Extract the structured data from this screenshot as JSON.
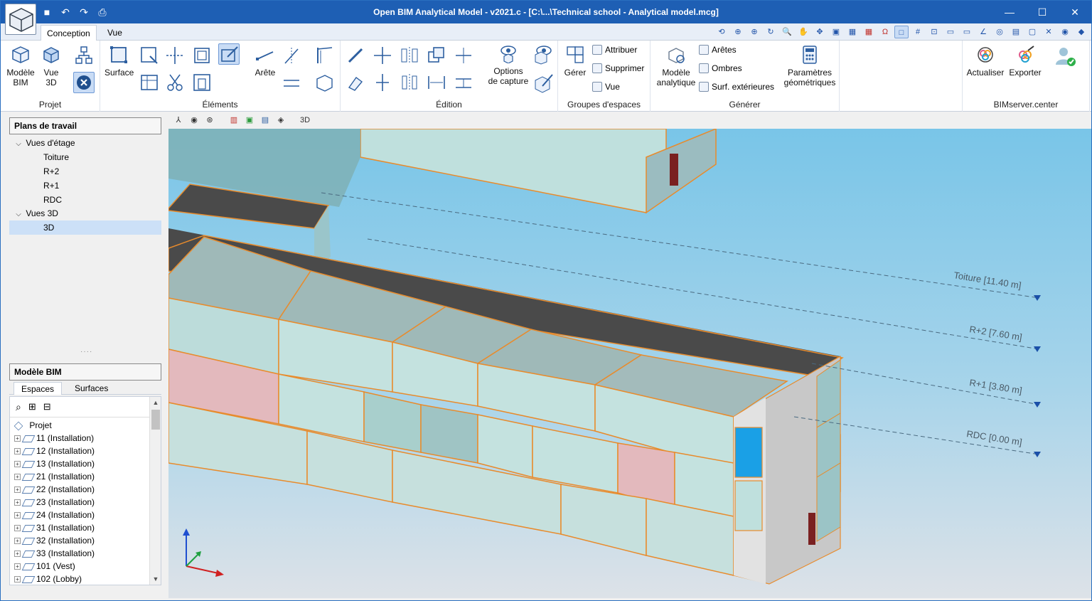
{
  "window": {
    "title": "Open BIM Analytical Model - v2021.c - [C:\\...\\Technical school - Analytical model.mcg]",
    "controls": [
      "—",
      "☐",
      "✕"
    ]
  },
  "tabs": [
    {
      "label": "Conception",
      "active": true
    },
    {
      "label": "Vue",
      "active": false
    }
  ],
  "ribbon": {
    "projet": {
      "label": "Projet",
      "modele_bim": "Modèle\nBIM",
      "vue_3d": "Vue\n3D"
    },
    "elements": {
      "label": "Éléments",
      "surface": "Surface",
      "arete": "Arête"
    },
    "edition": {
      "label": "Édition",
      "options_capture": "Options\nde capture"
    },
    "groupes": {
      "label": "Groupes d'espaces",
      "gerer": "Gérer",
      "attribuer": "Attribuer",
      "supprimer": "Supprimer",
      "vue": "Vue"
    },
    "generer": {
      "label": "Générer",
      "modele_analytique": "Modèle\nanalytique",
      "aretes": "Arêtes",
      "ombres": "Ombres",
      "surf_exterieures": "Surf. extérieures",
      "parametres": "Paramètres\ngéométriques"
    },
    "bimserver": {
      "label": "BIMserver.center",
      "actualiser": "Actualiser",
      "exporter": "Exporter"
    }
  },
  "plans": {
    "header": "Plans de travail",
    "vues_etage": "Vues d'étage",
    "floors": [
      "Toiture",
      "R+2",
      "R+1",
      "RDC"
    ],
    "vues_3d": "Vues 3D",
    "view_3d": "3D"
  },
  "modele_bim": {
    "header": "Modèle BIM",
    "subtabs": [
      "Espaces",
      "Surfaces"
    ],
    "root": "Projet",
    "items": [
      "11 (Installation)",
      "12 (Installation)",
      "13 (Installation)",
      "21 (Installation)",
      "22 (Installation)",
      "23 (Installation)",
      "24 (Installation)",
      "31 (Installation)",
      "32 (Installation)",
      "33 (Installation)",
      "101 (Vest)",
      "102 (Lobby)"
    ]
  },
  "scene": {
    "levels": [
      {
        "label": "Toiture [11.40 m]"
      },
      {
        "label": "R+2 [7.60 m]"
      },
      {
        "label": "R+1 [3.80 m]"
      },
      {
        "label": "RDC [0.00 m]"
      }
    ],
    "colors": {
      "sky_top": "#7ec7e8",
      "sky_bottom": "#d5dde4",
      "glass": "#b9d8d6",
      "roof": "#4a4a4a",
      "edge": "#e88b2c",
      "pink": "#e3b9bd",
      "blue_panel": "#1aa0e6"
    }
  }
}
